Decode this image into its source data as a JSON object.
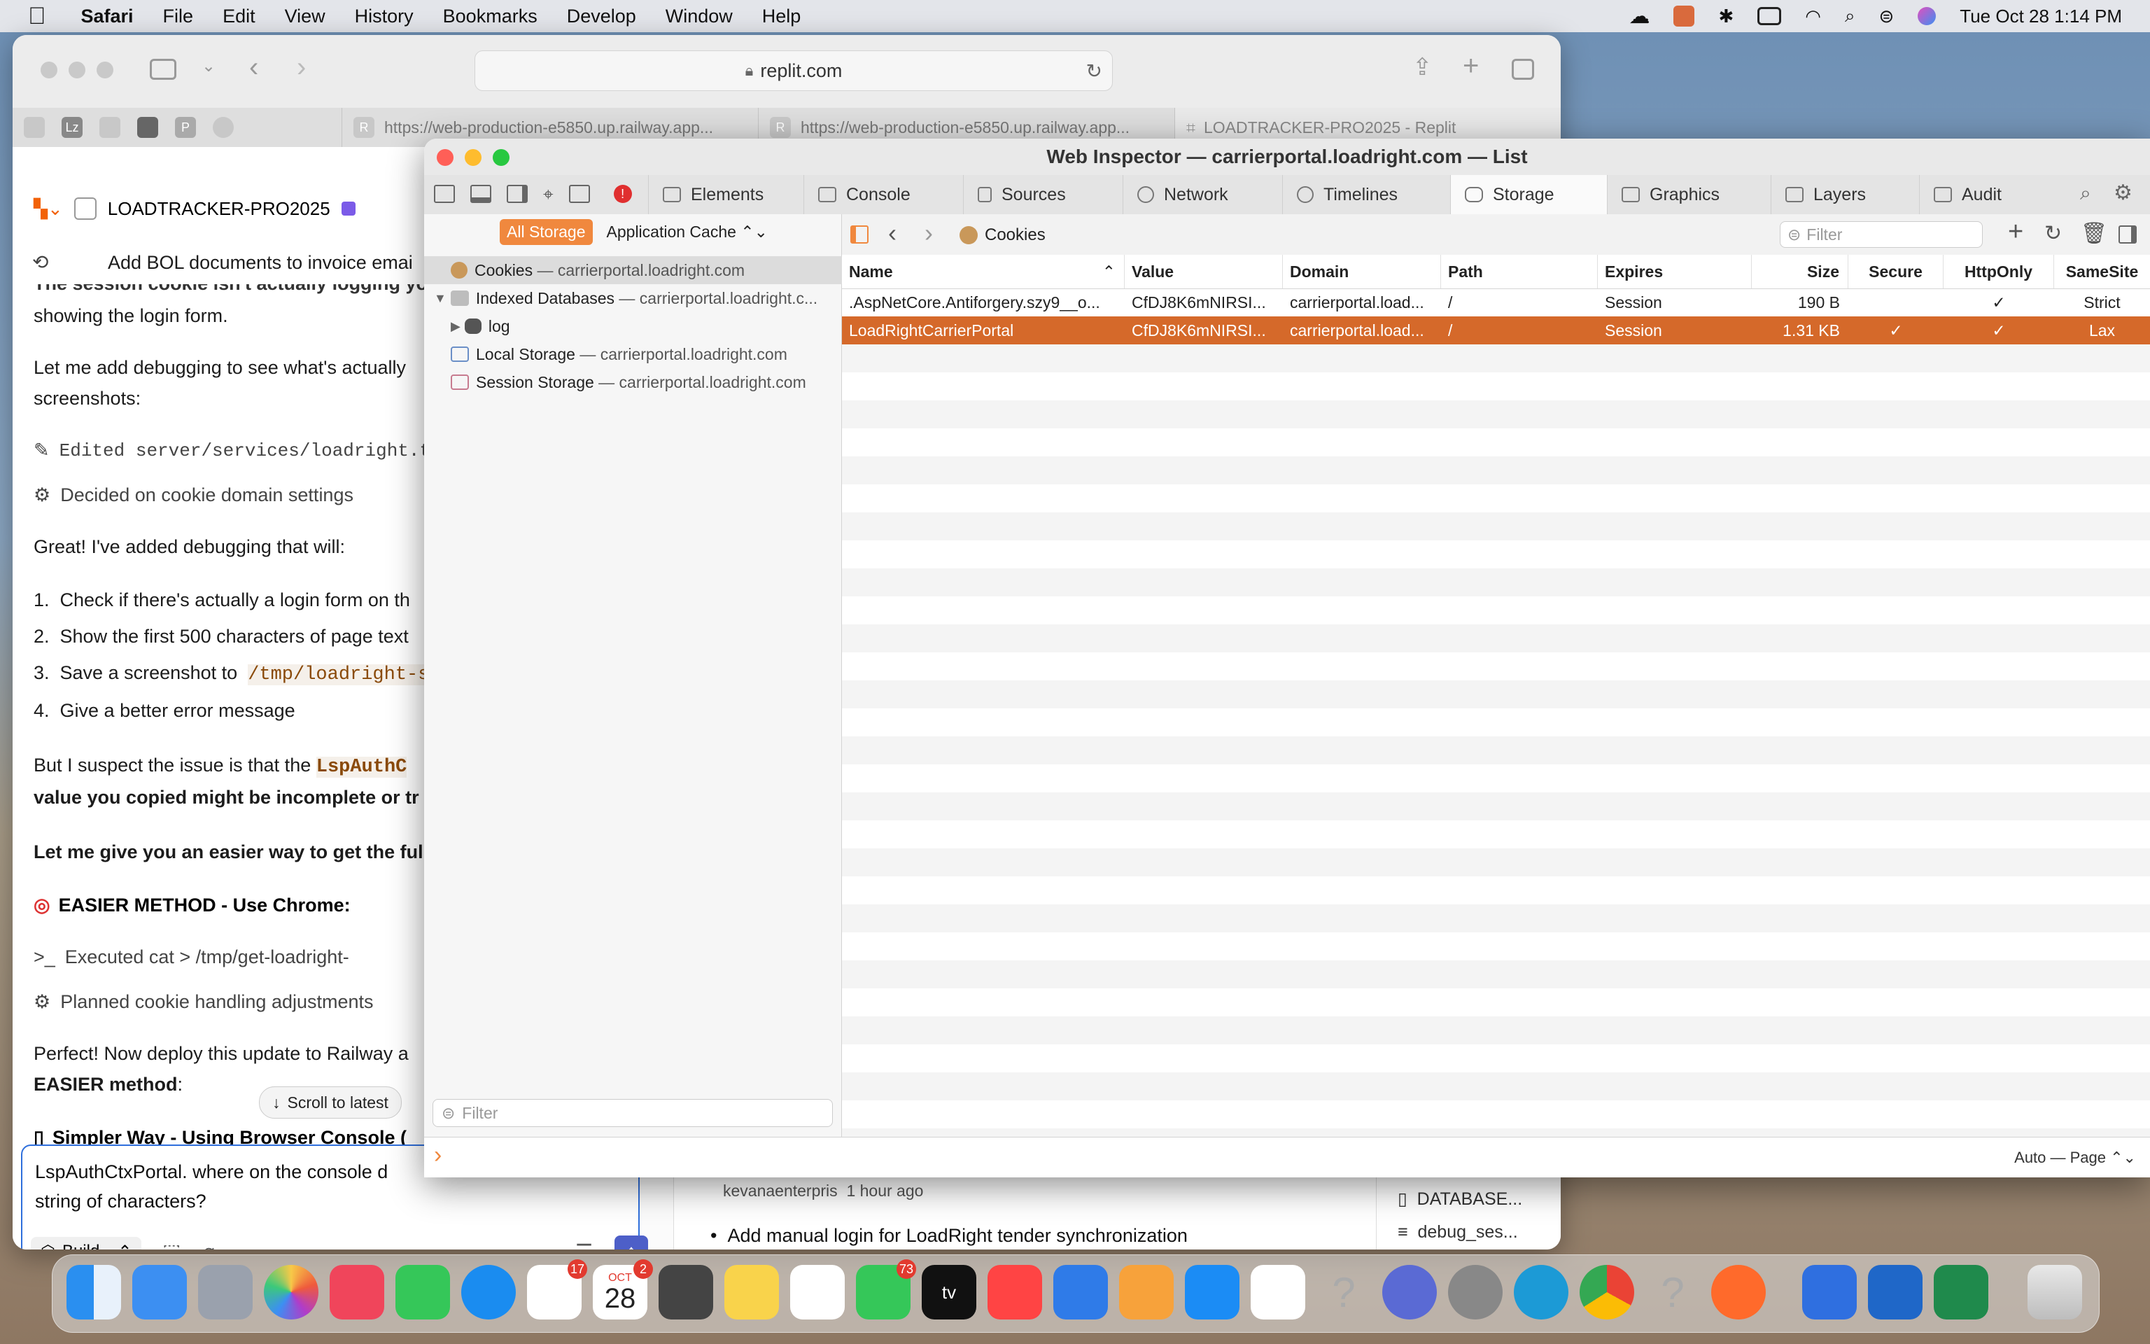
{
  "menubar": {
    "apple": "",
    "app": "Safari",
    "items": [
      "File",
      "Edit",
      "View",
      "History",
      "Bookmarks",
      "Develop",
      "Window",
      "Help"
    ],
    "clock": "Tue Oct 28  1:14 PM"
  },
  "safari": {
    "url": "replit.com",
    "tabs": [
      {
        "label": "https://web-production-e5850.up.railway.app..."
      },
      {
        "label": "https://web-production-e5850.up.railway.app..."
      },
      {
        "label": "LOADTRACKER-PRO2025 - Replit"
      }
    ]
  },
  "replit": {
    "project": "LOADTRACKER-PRO2025",
    "header_msg": "Add BOL documents to invoice emai",
    "lines": [
      "showing the login form.",
      "Let me add debugging to see what's actually",
      "screenshots:",
      "Edited server/services/loadright.ts",
      "Decided on cookie domain settings",
      "Great! I've added debugging that will:",
      "Check if there's actually a login form on th",
      "Show the first 500 characters of page text",
      "Save a screenshot to",
      "/tmp/loadright-s",
      "Give a better error message",
      "But I suspect the issue is that the",
      "LspAuthC",
      "value you copied might be incomplete or tr",
      "Let me give you an easier way to get the ful",
      "EASIER METHOD - Use Chrome:",
      "Executed cat > /tmp/get-loadright-",
      "Planned cookie handling adjustments",
      "Perfect! Now deploy this update to Railway a",
      "EASIER method",
      "Simpler Way - Using Browser Console (",
      "The session cookie isn't actually logging yo"
    ],
    "scroll_btn": "Scroll to latest",
    "input_text_1": "LspAuthCtxPortal.    where on the console d",
    "input_text_2": "string of characters?",
    "build_label": "Build",
    "commit_author": "kevanaenterpris",
    "commit_time": "1 hour ago",
    "commit_msg": "Add manual login for LoadRight tender synchronization",
    "files": [
      "DATABASE...",
      "debug_ses..."
    ]
  },
  "inspector": {
    "title": "Web Inspector — carrierportal.loadright.com — List",
    "tabs": [
      "Elements",
      "Console",
      "Sources",
      "Network",
      "Timelines",
      "Storage",
      "Graphics",
      "Layers",
      "Audit"
    ],
    "active_tab": "Storage",
    "filter_all": "All Storage",
    "filter_cache": "Application Cache",
    "sidebar": [
      {
        "label": "Cookies",
        "domain": "— carrierportal.loadright.com"
      },
      {
        "label": "Indexed Databases",
        "domain": "— carrierportal.loadright.c..."
      },
      {
        "label": "log",
        "domain": ""
      },
      {
        "label": "Local Storage",
        "domain": "— carrierportal.loadright.com"
      },
      {
        "label": "Session Storage",
        "domain": "— carrierportal.loadright.com"
      }
    ],
    "breadcrumb": "Cookies",
    "filter_placeholder": "Filter",
    "sidebar_filter": "Filter",
    "columns": [
      "Name",
      "Value",
      "Domain",
      "Path",
      "Expires",
      "Size",
      "Secure",
      "HttpOnly",
      "SameSite"
    ],
    "rows": [
      {
        "name": ".AspNetCore.Antiforgery.szy9__o...",
        "value": "CfDJ8K6mNIRSI...",
        "domain": "carrierportal.load...",
        "path": "/",
        "expires": "Session",
        "size": "190 B",
        "secure": "",
        "httponly": "✓",
        "samesite": "Strict"
      },
      {
        "name": "LoadRightCarrierPortal",
        "value": "CfDJ8K6mNIRSI...",
        "domain": "carrierportal.load...",
        "path": "/",
        "expires": "Session",
        "size": "1.31 KB",
        "secure": "✓",
        "httponly": "✓",
        "samesite": "Lax"
      }
    ],
    "console_prompt": "›",
    "console_mode": "Auto — Page"
  },
  "dock": {
    "reminders_badge": "17",
    "calendar_month": "OCT",
    "calendar_day": "28",
    "calendar_badge": "2",
    "messages_badge": "73",
    "tv_label": "tv"
  },
  "colors": {
    "accent": "#d5692a",
    "storage_pill": "#f0883e",
    "link": "#2f6fdc"
  }
}
